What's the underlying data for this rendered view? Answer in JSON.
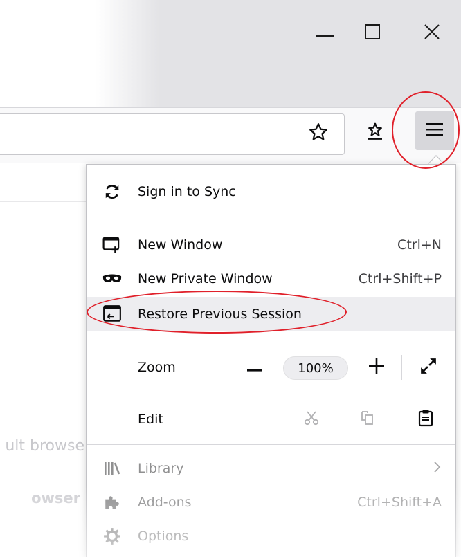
{
  "window_controls": {
    "minimize_icon": "minimize-icon",
    "maximize_icon": "maximize-icon",
    "close_icon": "close-icon"
  },
  "toolbar": {
    "bookmark_star_icon": "star-outline-icon",
    "library_icon": "bookmark-star-tray-icon",
    "menu_icon": "hamburger-menu-icon"
  },
  "background_page": {
    "text_1": "ult browse",
    "text_2": "owser"
  },
  "menu": {
    "sync": {
      "label": "Sign in to Sync",
      "icon": "sync-icon"
    },
    "new_window": {
      "label": "New Window",
      "shortcut": "Ctrl+N",
      "icon": "new-window-icon"
    },
    "private_window": {
      "label": "New Private Window",
      "shortcut": "Ctrl+Shift+P",
      "icon": "private-mask-icon"
    },
    "restore_session": {
      "label": "Restore Previous Session",
      "icon": "restore-session-icon"
    },
    "zoom": {
      "label": "Zoom",
      "value": "100%",
      "minus": "−",
      "plus": "+"
    },
    "edit": {
      "label": "Edit"
    },
    "library": {
      "label": "Library",
      "icon": "library-icon"
    },
    "addons": {
      "label": "Add-ons",
      "shortcut": "Ctrl+Shift+A",
      "icon": "puzzle-icon"
    },
    "options": {
      "label": "Options",
      "icon": "gear-icon"
    }
  },
  "colors": {
    "annotation": "#e0202a",
    "hover": "#ededf0",
    "titlebar": "#e3e3e6"
  }
}
